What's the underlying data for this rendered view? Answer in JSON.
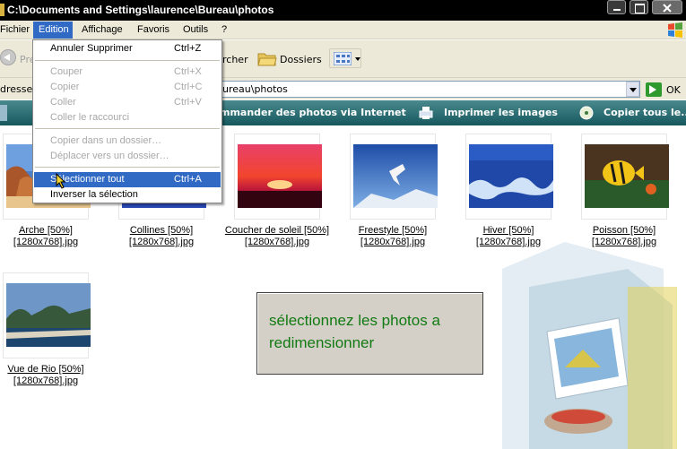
{
  "window": {
    "title": "C:\\Documents and Settings\\laurence\\Bureau\\photos"
  },
  "menubar": {
    "items": [
      "Fichier",
      "Edition",
      "Affichage",
      "Favoris",
      "Outils",
      "?"
    ],
    "active": "Edition"
  },
  "toolbar": {
    "back_label": "Pré",
    "search_label": "rcher",
    "folders_label": "Dossiers"
  },
  "address": {
    "label": "dresse",
    "value": "ureau\\photos",
    "go_label": "OK"
  },
  "taskband": {
    "order_label": "mmander des photos via Internet",
    "print_label": "Imprimer les images",
    "copy_label": "Copier tous le..."
  },
  "edition_menu": {
    "items": [
      {
        "label": "Annuler Supprimer",
        "shortcut": "Ctrl+Z",
        "enabled": true
      },
      {
        "label": "Couper",
        "shortcut": "Ctrl+X",
        "enabled": false
      },
      {
        "label": "Copier",
        "shortcut": "Ctrl+C",
        "enabled": false
      },
      {
        "label": "Coller",
        "shortcut": "Ctrl+V",
        "enabled": false
      },
      {
        "label": "Coller le raccourci",
        "shortcut": "",
        "enabled": false
      },
      {
        "label": "Copier dans un dossier…",
        "shortcut": "",
        "enabled": false
      },
      {
        "label": "Déplacer vers un dossier…",
        "shortcut": "",
        "enabled": false
      },
      {
        "label": "Sélectionner tout",
        "shortcut": "Ctrl+A",
        "enabled": true,
        "selected": true
      },
      {
        "label": "Inverser la sélection",
        "shortcut": "",
        "enabled": true
      }
    ]
  },
  "files": [
    {
      "name": "Arche [50%]",
      "dims": "[1280x768].jpg"
    },
    {
      "name": "Collines [50%]",
      "dims": "[1280x768].jpg"
    },
    {
      "name": "Coucher de soleil [50%]",
      "dims": "[1280x768].jpg"
    },
    {
      "name": "Freestyle [50%]",
      "dims": "[1280x768].jpg"
    },
    {
      "name": "Hiver [50%]",
      "dims": "[1280x768].jpg"
    },
    {
      "name": "Poisson [50%]",
      "dims": "[1280x768].jpg"
    },
    {
      "name": "Vue de Rio [50%]",
      "dims": "[1280x768].jpg"
    }
  ],
  "infobox": {
    "text": "sélectionnez les photos a redimensionner"
  },
  "colors": {
    "menu_highlight": "#316ac5",
    "task_band": "#1f6a70",
    "infobox_text": "#127a12"
  }
}
